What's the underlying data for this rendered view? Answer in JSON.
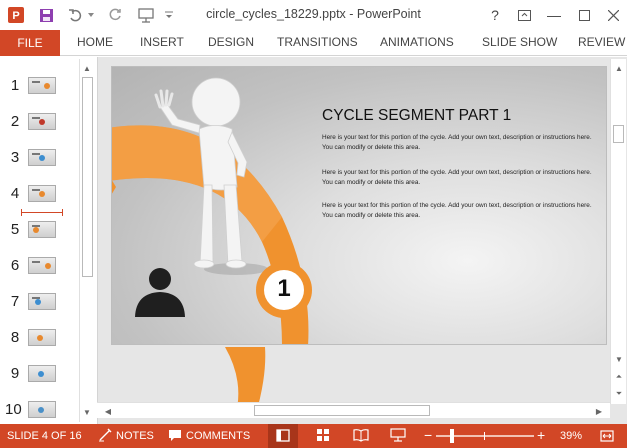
{
  "titlebar": {
    "document_title": "circle_cycles_18229.pptx - PowerPoint",
    "help": "?",
    "min": "—"
  },
  "ribbon": {
    "file": "FILE",
    "tabs": [
      "HOME",
      "INSERT",
      "DESIGN",
      "TRANSITIONS",
      "ANIMATIONS",
      "SLIDE SHOW",
      "REVIEW"
    ]
  },
  "thumbnails": {
    "numbers": [
      "1",
      "2",
      "3",
      "4",
      "5",
      "6",
      "7",
      "8",
      "9",
      "10"
    ],
    "selected_index": 4
  },
  "slide": {
    "title": "CYCLE SEGMENT PART 1",
    "paragraphs": [
      "Here is your text for this portion of the cycle. Add your own text, description or instructions here. You can modify or delete this area.",
      "Here is your text for this portion of the cycle. Add your own text, description or instructions here. You can modify or delete this area.",
      "Here is your text for this portion of the cycle. Add your own text, description or instructions here. You can modify or delete this area."
    ],
    "badge_number": "1",
    "accent_color": "#f0922e"
  },
  "statusbar": {
    "slide_info": "SLIDE 4 OF 16",
    "notes": "NOTES",
    "comments": "COMMENTS",
    "zoom": "39%",
    "zoom_minus": "−",
    "zoom_plus": "+",
    "zoom_level": 0.39
  },
  "colors": {
    "brand": "#d24726",
    "slide_bg": "#c8c8c8"
  }
}
